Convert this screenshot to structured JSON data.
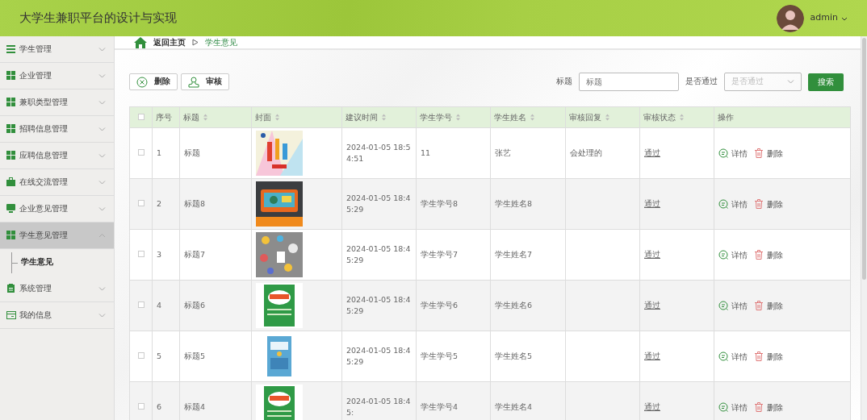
{
  "header": {
    "title": "大学生兼职平台的设计与实现",
    "user": "admin"
  },
  "sidebar": {
    "items": [
      {
        "label": "学生管理",
        "kind": "list",
        "expanded": false,
        "selected": false
      },
      {
        "label": "企业管理",
        "kind": "grid",
        "expanded": false,
        "selected": false
      },
      {
        "label": "兼职类型管理",
        "kind": "grid",
        "expanded": false,
        "selected": false
      },
      {
        "label": "招聘信息管理",
        "kind": "grid",
        "expanded": false,
        "selected": false
      },
      {
        "label": "应聘信息管理",
        "kind": "grid",
        "expanded": false,
        "selected": false
      },
      {
        "label": "在线交流管理",
        "kind": "briefcase",
        "expanded": false,
        "selected": false
      },
      {
        "label": "企业意见管理",
        "kind": "monitor",
        "expanded": false,
        "selected": false
      },
      {
        "label": "学生意见管理",
        "kind": "grid",
        "expanded": true,
        "selected": true,
        "children": [
          {
            "label": "学生意见",
            "selected": true
          }
        ]
      },
      {
        "label": "系统管理",
        "kind": "clipboard",
        "expanded": false,
        "selected": false
      },
      {
        "label": "我的信息",
        "kind": "card",
        "expanded": false,
        "selected": false
      }
    ]
  },
  "breadcrumb": {
    "home": "返回主页",
    "current": "学生意见"
  },
  "toolbar": {
    "buttons": [
      {
        "label": "删除",
        "kind": "delete"
      },
      {
        "label": "审核",
        "kind": "review"
      }
    ]
  },
  "search": {
    "fields": [
      {
        "label": "标题",
        "kind": "text",
        "placeholder": "标题"
      },
      {
        "label": "是否通过",
        "kind": "select",
        "placeholder": "是否通过"
      }
    ],
    "button": "搜索"
  },
  "table": {
    "header_checked": false,
    "columns": [
      {
        "label": "序号",
        "sortable": false
      },
      {
        "label": "标题",
        "sortable": true
      },
      {
        "label": "封面",
        "sortable": true
      },
      {
        "label": "建议时间",
        "sortable": true
      },
      {
        "label": "学生学号",
        "sortable": true
      },
      {
        "label": "学生姓名",
        "sortable": true
      },
      {
        "label": "审核回复",
        "sortable": true
      },
      {
        "label": "审核状态",
        "sortable": true
      },
      {
        "label": "操作",
        "sortable": false
      }
    ],
    "rows": [
      {
        "checked": false,
        "no": "1",
        "title": "标题",
        "time": "2024-01-05 18:54:51",
        "student_no": "11",
        "student_name": "张艺",
        "reply": "会处理的",
        "status": "通过",
        "actions": [
          "详情",
          "删除"
        ]
      },
      {
        "checked": false,
        "no": "2",
        "title": "标题8",
        "time": "2024-01-05 18:45:29",
        "student_no": "学生学号8",
        "student_name": "学生姓名8",
        "reply": "",
        "status": "通过",
        "actions": [
          "详情",
          "删除"
        ]
      },
      {
        "checked": false,
        "no": "3",
        "title": "标题7",
        "time": "2024-01-05 18:45:29",
        "student_no": "学生学号7",
        "student_name": "学生姓名7",
        "reply": "",
        "status": "通过",
        "actions": [
          "详情",
          "删除"
        ]
      },
      {
        "checked": false,
        "no": "4",
        "title": "标题6",
        "time": "2024-01-05 18:45:29",
        "student_no": "学生学号6",
        "student_name": "学生姓名6",
        "reply": "",
        "status": "通过",
        "actions": [
          "详情",
          "删除"
        ]
      },
      {
        "checked": false,
        "no": "5",
        "title": "标题5",
        "time": "2024-01-05 18:45:29",
        "student_no": "学生学号5",
        "student_name": "学生姓名5",
        "reply": "",
        "status": "通过",
        "actions": [
          "详情",
          "删除"
        ]
      },
      {
        "checked": false,
        "no": "6",
        "title": "标题4",
        "time": "2024-01-05 18:45:",
        "student_no": "学生学号4",
        "student_name": "学生姓名4",
        "reply": "",
        "status": "通过",
        "actions": [
          "详情",
          "删除"
        ]
      }
    ]
  }
}
